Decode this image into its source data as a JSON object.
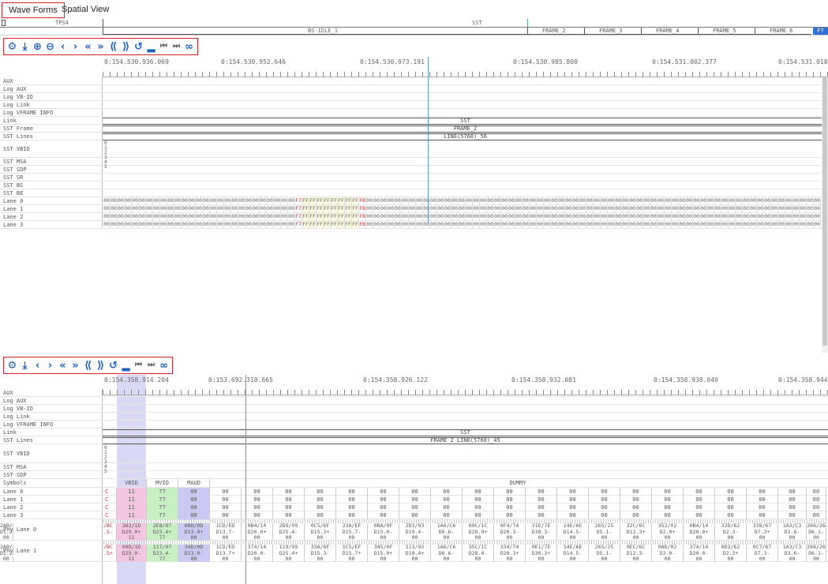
{
  "tabs": [
    {
      "label": "Wave Forms"
    },
    {
      "label": "Spatial View"
    }
  ],
  "top_bar": {
    "row1": "TPS4",
    "row1_sst": "SST",
    "row2": "BS-IDLE_1",
    "frames": [
      "FRAME_2",
      "FRAME_3",
      "FRAME_4",
      "FRAME_5",
      "FRAME_6"
    ],
    "frame_last": "F7"
  },
  "toolbar1": {
    "icons": [
      "settings-icon",
      "export-icon",
      "zoom-in-icon",
      "zoom-out-icon",
      "prev-icon",
      "next-icon",
      "fast-rewind-icon",
      "fast-forward-icon",
      "skip-back-icon",
      "skip-forward-icon",
      "history-icon",
      "ruler-icon",
      "first-icon",
      "last-icon",
      "link-icon"
    ]
  },
  "toolbar2": {
    "icons": [
      "settings-icon",
      "export-icon",
      "prev-icon",
      "next-icon",
      "fast-rewind-icon",
      "fast-forward-icon",
      "skip-back-icon",
      "skip-forward-icon",
      "history-icon",
      "ruler-icon",
      "first-icon",
      "last-icon",
      "link-icon"
    ]
  },
  "panel1": {
    "timestamps": [
      "0:154.530.936.069",
      "0:154.530.952.646",
      "0:154.530.973.191",
      "0:154.530.985.800",
      "0:154.531.002.377",
      "0:154.531.018"
    ],
    "rows": [
      "AUX",
      "Log AUX",
      "Log VB-ID",
      "Log Link",
      "Log VFRAME INFO",
      "Link",
      "SST Frame",
      "SST Lines",
      "SST VBID",
      "SST MSA",
      "SST SDP",
      "SST SR",
      "SST BS",
      "SST BE",
      "Lane 0",
      "Lane 1",
      "Lane 2",
      "Lane 3"
    ],
    "link_text": "SST",
    "frame_text": "FRAME_2",
    "lines_text": "LINE(5760)_56",
    "vbid_bits": "0\n1\n2\n3\n4\n5",
    "hex_zero": "00",
    "hex_f7": "F7",
    "hex_ff": "FF",
    "hex_fb": "FB"
  },
  "panel2": {
    "timestamps": [
      "0:154.358.914.204",
      "0:153.692.310.665",
      "0:154.358.926.122",
      "0:154.358.932.081",
      "0:154.358.938.040",
      "0:154.358.944"
    ],
    "rows": [
      "AUX",
      "Log AUX",
      "Log VB-ID",
      "Log Link",
      "Log VFRAME INFO",
      "Link",
      "SST Lines",
      "SST VBID",
      "SST MSA",
      "SST SDP",
      "Symbols",
      "Lane 0",
      "Lane 1",
      "Lane 2",
      "Lane 3",
      "Phy Lane 0",
      "Phy Lane 1"
    ],
    "link_text": "SST",
    "lines_text": "FRAME 2 LINE(5760)_45",
    "vbid_bits": "0\n1\n2\n3\n4\n5",
    "symbols": [
      "VBID",
      "MVID",
      "MAUD",
      "DUMMY"
    ],
    "lane_values": [
      "11",
      "77",
      "00"
    ],
    "lane_prefix": "C",
    "phy0": [
      [
        "/BC",
        ".5-",
        ""
      ],
      [
        "362/1D",
        "D29.0+",
        "11"
      ],
      [
        "2E8/97",
        "D23.4+",
        "77"
      ],
      [
        "08D/0D",
        "D13.0+",
        "00"
      ],
      [
        "1CD/ED",
        "D13.7-",
        "00"
      ],
      [
        "0B4/14",
        "D20.0+",
        "00"
      ],
      [
        "2D9/99",
        "D25.4-",
        "00"
      ],
      [
        "0C5/6F",
        "D15.3+",
        "00"
      ],
      [
        "23A/EF",
        "D15.7-",
        "00"
      ],
      [
        "0BA/0F",
        "D15.0-",
        "00"
      ],
      [
        "2D3/93",
        "D19.4-",
        "00"
      ],
      [
        "1A6/C6",
        "D6.6-",
        "00"
      ],
      [
        "09C/1C",
        "D28.0+",
        "00"
      ],
      [
        "0F4/74",
        "D20.3-",
        "00"
      ],
      [
        "31E/7E",
        "D30.3-",
        "00"
      ],
      [
        "14E/AE",
        "D14.5-",
        "00"
      ],
      [
        "265/25",
        "D5.1-",
        "00"
      ],
      [
        "32C/6C",
        "D12.3+",
        "00"
      ],
      [
        "352/02",
        "D2.0+",
        "00"
      ],
      [
        "0B4/14",
        "D20.0+",
        "00"
      ],
      [
        "32D/62",
        "D2.3-",
        "00"
      ],
      [
        "338/67",
        "D7.3+",
        "00"
      ],
      [
        "1A3/C3",
        "D3.6-",
        "00"
      ],
      [
        "266/26",
        "D6.1-",
        "00"
      ],
      [
        "2AB/",
        "D1.2",
        "00"
      ]
    ],
    "phy1": [
      [
        "/BC",
        ".5+",
        ""
      ],
      [
        "09D/1D",
        "D29.0-",
        "11"
      ],
      [
        "117/97",
        "D23.4-",
        "77"
      ],
      [
        "34D/0D",
        "D13.0-",
        "00"
      ],
      [
        "1CD/ED",
        "D13.7+",
        "00"
      ],
      [
        "374/14",
        "D20.0-",
        "00"
      ],
      [
        "119/99",
        "D25.4+",
        "00"
      ],
      [
        "33A/6F",
        "D15.3-",
        "00"
      ],
      [
        "1C5/EF",
        "D15.7+",
        "00"
      ],
      [
        "345/0F",
        "D15.0+",
        "00"
      ],
      [
        "113/93",
        "D19.4+",
        "00"
      ],
      [
        "1A6/C6",
        "D6.6-",
        "00"
      ],
      [
        "35C/1C",
        "D28.0-",
        "00"
      ],
      [
        "334/74",
        "D20.3+",
        "00"
      ],
      [
        "0E1/7E",
        "D30.3+",
        "00"
      ],
      [
        "14E/AE",
        "D14.5-",
        "00"
      ],
      [
        "265/25",
        "D5.1-",
        "00"
      ],
      [
        "0EC/6C",
        "D12.3-",
        "00"
      ],
      [
        "0AD/02",
        "D2.0-",
        "00"
      ],
      [
        "374/14",
        "D20.0-",
        "00"
      ],
      [
        "0D2/62",
        "D2.3+",
        "00"
      ],
      [
        "0C7/67",
        "D7.3-",
        "00"
      ],
      [
        "1A3/C3",
        "D3.6-",
        "00"
      ],
      [
        "266/26",
        "D6.1-",
        "00"
      ],
      [
        "2AB/",
        "D1.2",
        "00"
      ]
    ]
  },
  "colors": {
    "accent": "#d9232b",
    "cursor": "#5b9bd5",
    "vbid": "#f2c6e0",
    "mvid": "#c8f0c4",
    "maud": "#c9c9f2",
    "highlight": "#d9d9f5"
  }
}
